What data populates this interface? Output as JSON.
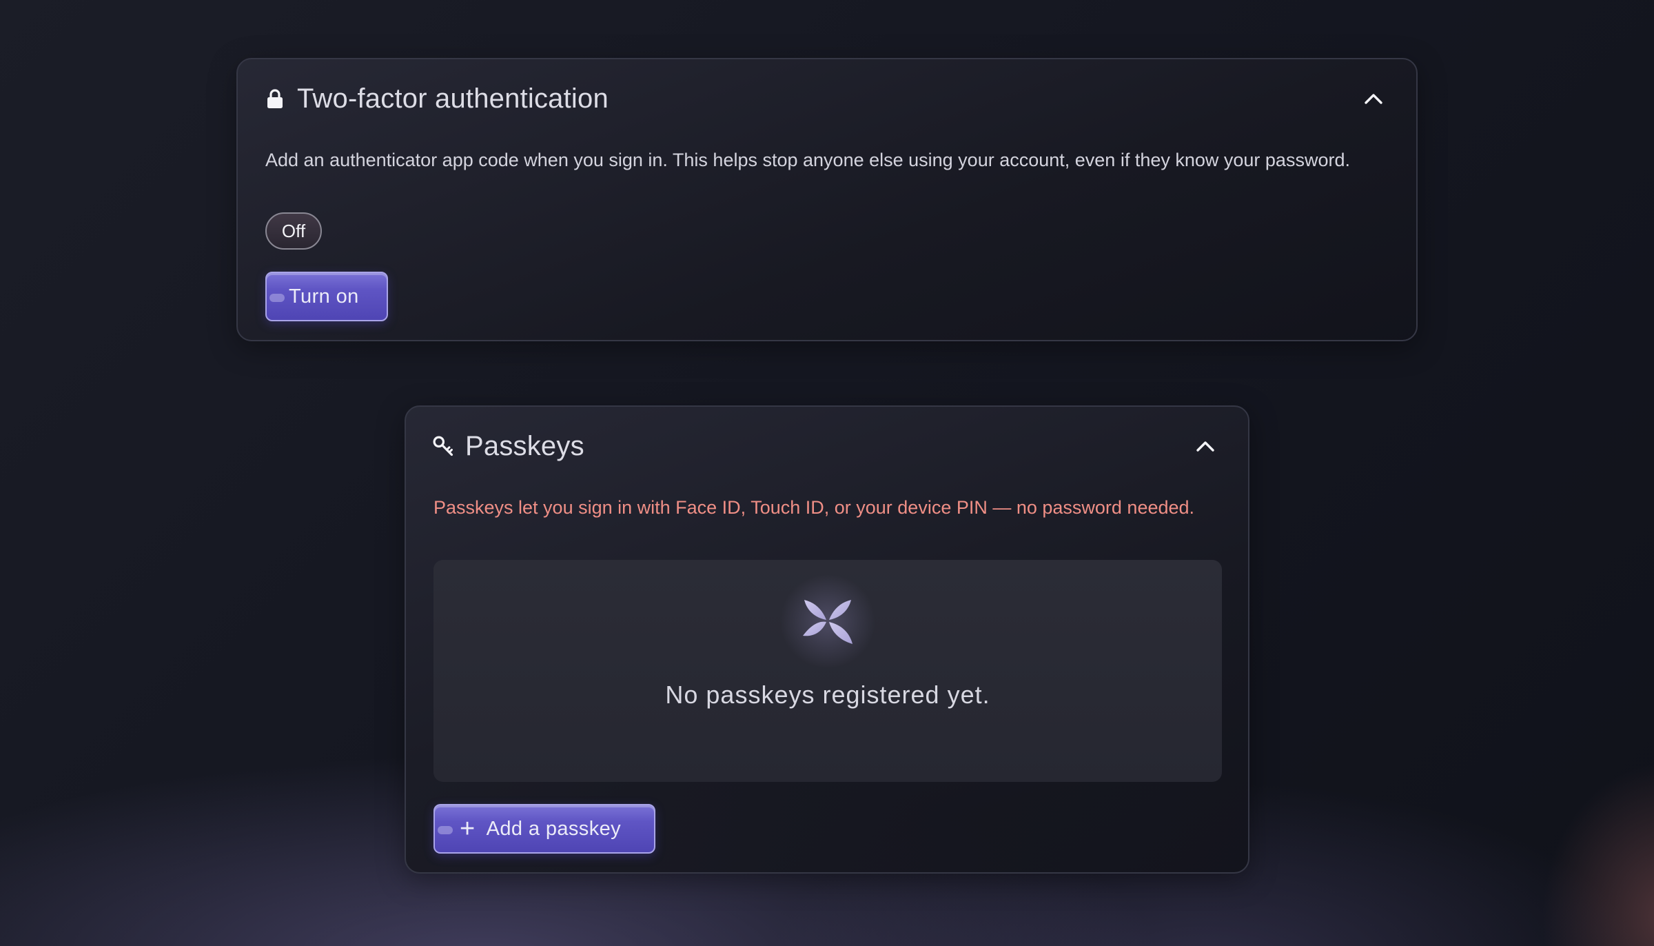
{
  "two_factor": {
    "title": "Two-factor authentication",
    "icon": "lock-icon",
    "description": "Add an authenticator app code when you sign in. This helps stop anyone else using your account, even if they know your password.",
    "status": "Off",
    "action_label": "Turn on",
    "collapse_icon": "chevron-up-icon"
  },
  "passkeys": {
    "title": "Passkeys",
    "icon": "key-icon",
    "description": "Passkeys let you sign in with Face ID, Touch ID, or your device PIN — no password needed.",
    "empty_state": {
      "icon": "butterfly-icon",
      "text": "No passkeys registered yet."
    },
    "action_label": "Add a passkey",
    "action_icon": "plus-icon",
    "collapse_icon": "chevron-up-icon"
  },
  "colors": {
    "accent": "#5f55c4",
    "accent_border": "#a9a4e8",
    "warning_text": "#f08f86",
    "card_border": "#353745"
  }
}
